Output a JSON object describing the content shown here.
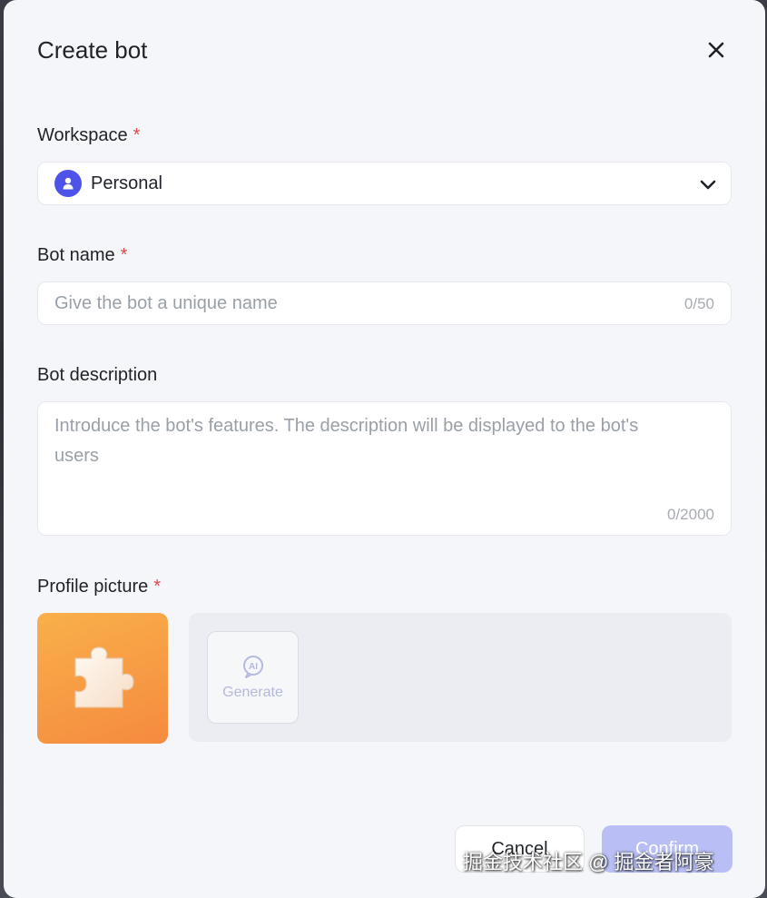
{
  "dialog": {
    "title": "Create bot"
  },
  "workspace": {
    "label": "Workspace",
    "required_mark": "*",
    "selected_value": "Personal"
  },
  "bot_name": {
    "label": "Bot name",
    "required_mark": "*",
    "placeholder": "Give the bot a unique name",
    "counter": "0/50"
  },
  "bot_description": {
    "label": "Bot description",
    "placeholder": "Introduce the bot's features. The description will be displayed to the bot's users",
    "counter": "0/2000"
  },
  "profile_picture": {
    "label": "Profile picture",
    "required_mark": "*",
    "generate_label": "Generate",
    "ai_badge": "AI"
  },
  "footer": {
    "cancel_label": "Cancel",
    "confirm_label": "Confirm"
  },
  "watermark": {
    "text": "掘金技术社区 @ 掘金者阿豪"
  },
  "colors": {
    "accent": "#4d53e8",
    "required": "#e5484d",
    "confirm_disabled": "#b9bff5",
    "avatar_gradient_top": "#f9b04a",
    "avatar_gradient_bottom": "#f58a3f"
  },
  "icons": {
    "close": "close-icon",
    "workspace": "user-icon",
    "dropdown": "chevron-down-icon",
    "avatar": "puzzle-piece-icon",
    "generate": "ai-sparkle-icon"
  }
}
